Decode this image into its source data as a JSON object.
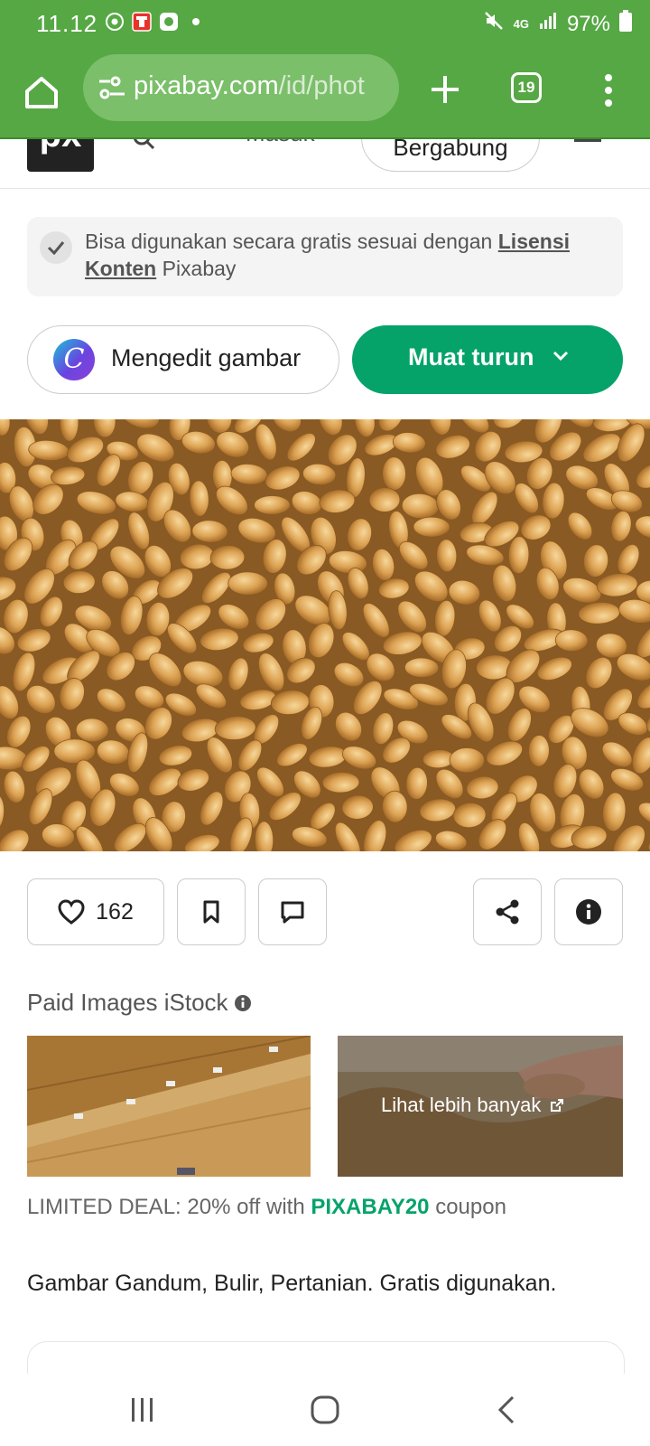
{
  "status_bar": {
    "time": "11.12",
    "network": "4G",
    "battery": "97%"
  },
  "browser": {
    "url_host": "pixabay.com",
    "url_path": "/id/phot",
    "tab_count": "19"
  },
  "site_header": {
    "logo_text": "px",
    "login_label": "Masuk",
    "join_label": "Bergabung"
  },
  "license": {
    "text_prefix": "Bisa digunakan secara gratis sesuai dengan ",
    "link_text": "Lisensi Konten",
    "text_suffix": " Pixabay"
  },
  "buttons": {
    "edit_label": "Mengedit gambar",
    "canva_letter": "C",
    "download_label": "Muat turun"
  },
  "actions": {
    "like_count": "162"
  },
  "paid_images": {
    "title": "Paid Images iStock",
    "more_label": "Lihat lebih banyak"
  },
  "deal": {
    "prefix": "LIMITED DEAL: 20% off with ",
    "code": "PIXABAY20",
    "suffix": " coupon"
  },
  "caption": "Gambar Gandum, Bulir, Pertanian. Gratis digunakan.",
  "colors": {
    "browser_green": "#56a844",
    "accent_green": "#05a36a"
  },
  "icons": [
    "home-icon",
    "tune-icon",
    "plus-icon",
    "tabs-icon",
    "more-vert-icon",
    "search-icon",
    "menu-icon",
    "check-icon",
    "chevron-down-icon",
    "heart-icon",
    "bookmark-icon",
    "comment-icon",
    "share-icon",
    "info-icon",
    "external-link-icon"
  ]
}
